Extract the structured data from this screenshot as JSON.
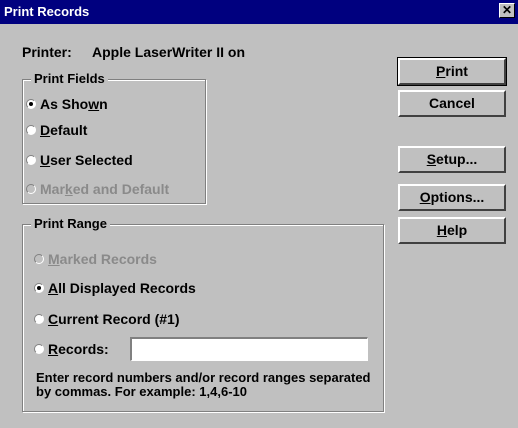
{
  "window": {
    "title": "Print Records",
    "close_glyph": "✕"
  },
  "printer": {
    "label": "Printer:",
    "name": "Apple LaserWriter II on"
  },
  "print_fields": {
    "legend": "Print Fields",
    "options": [
      {
        "pre": "As Sho",
        "u": "w",
        "post": "n",
        "checked": true,
        "enabled": true
      },
      {
        "pre": "",
        "u": "D",
        "post": "efault",
        "checked": false,
        "enabled": true
      },
      {
        "pre": "",
        "u": "U",
        "post": "ser Selected",
        "checked": false,
        "enabled": true
      },
      {
        "pre": "Mar",
        "u": "k",
        "post": "ed and Default",
        "checked": false,
        "enabled": false
      }
    ]
  },
  "print_range": {
    "legend": "Print Range",
    "options": [
      {
        "pre": "",
        "u": "M",
        "post": "arked Records",
        "checked": false,
        "enabled": false
      },
      {
        "pre": "",
        "u": "A",
        "post": "ll Displayed Records",
        "checked": true,
        "enabled": true
      },
      {
        "pre": "",
        "u": "C",
        "post": "urrent Record (#1)",
        "checked": false,
        "enabled": true
      },
      {
        "pre": "",
        "u": "R",
        "post": "ecords:",
        "checked": false,
        "enabled": true
      }
    ],
    "records_value": "",
    "help_text": "Enter record numbers and/or record ranges separated by commas. For example: 1,4,6-10"
  },
  "buttons": [
    {
      "pre": "",
      "u": "P",
      "post": "rint",
      "default": true
    },
    {
      "pre": "Cancel",
      "u": "",
      "post": "",
      "default": false
    },
    {
      "pre": "",
      "u": "S",
      "post": "etup...",
      "default": false
    },
    {
      "pre": "",
      "u": "O",
      "post": "ptions...",
      "default": false
    },
    {
      "pre": "",
      "u": "H",
      "post": "elp",
      "default": false
    }
  ]
}
